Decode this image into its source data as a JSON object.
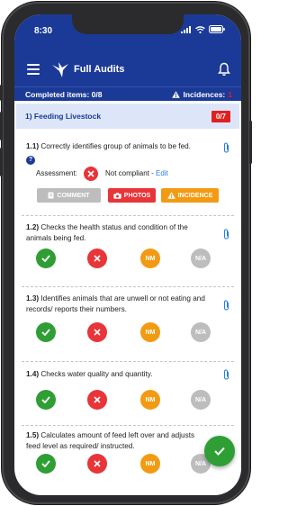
{
  "status_bar": {
    "time": "8:30"
  },
  "app": {
    "title": "Full Audits"
  },
  "progress": {
    "completed_label": "Completed items: 0/8",
    "incidences_label": "Incidences:",
    "incidences_count": "1"
  },
  "section": {
    "title": "1) Feeding Livestock",
    "badge": "0/7"
  },
  "answer_labels": {
    "nm": "NM",
    "na": "N/A"
  },
  "questions": [
    {
      "number": "1.1)",
      "text": "Correctly identifies group of animals to be fed."
    },
    {
      "number": "1.2)",
      "text": "Checks the health status and condition of the animals being fed."
    },
    {
      "number": "1.3)",
      "text": "Identifies animals that are unwell or not eating and records/ reports their numbers."
    },
    {
      "number": "1.4)",
      "text": "Checks water quality and quantity."
    },
    {
      "number": "1.5)",
      "text": "Calculates amount of feed left over and adjusts feed level as required/ instructed."
    }
  ],
  "assessment": {
    "label": "Assessment:",
    "status": "Not compliant",
    "separator": " - ",
    "edit": "Edit",
    "help": "?"
  },
  "actions": {
    "comment": "COMMENT",
    "photos": "PHOTOS",
    "incidence": "INCIDENCE"
  },
  "colors": {
    "primary": "#1b3a97",
    "section_bg": "#dde6f8",
    "compliant": "#2f9e35",
    "noncompliant": "#e8353a",
    "nm": "#f39a13",
    "na": "#bdbdbd"
  }
}
